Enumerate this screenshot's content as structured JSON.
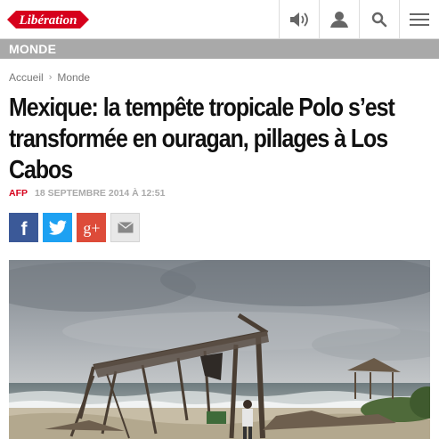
{
  "header": {
    "logo_text": "Libération",
    "icons": [
      "speaker-icon",
      "user-icon",
      "search-icon",
      "menu-icon"
    ]
  },
  "section": {
    "label": "MONDE"
  },
  "breadcrumb": {
    "items": [
      "Accueil",
      "Monde"
    ]
  },
  "article": {
    "title": "Mexique: la tempête tropicale Polo s’est transformée en ouragan, pillages à Los Cabos",
    "source": "AFP",
    "date": "18 SEPTEMBRE 2014 À 12:51"
  },
  "share": {
    "buttons": [
      "facebook-icon",
      "twitter-icon",
      "google-plus-icon",
      "mail-icon"
    ],
    "facebook_glyph": "f",
    "google_glyph": "g+"
  },
  "colors": {
    "brand_red": "#d6001c",
    "section_gray": "#a9a9a9",
    "facebook": "#3b5998",
    "twitter": "#1da1f2",
    "google": "#dd4b39"
  }
}
